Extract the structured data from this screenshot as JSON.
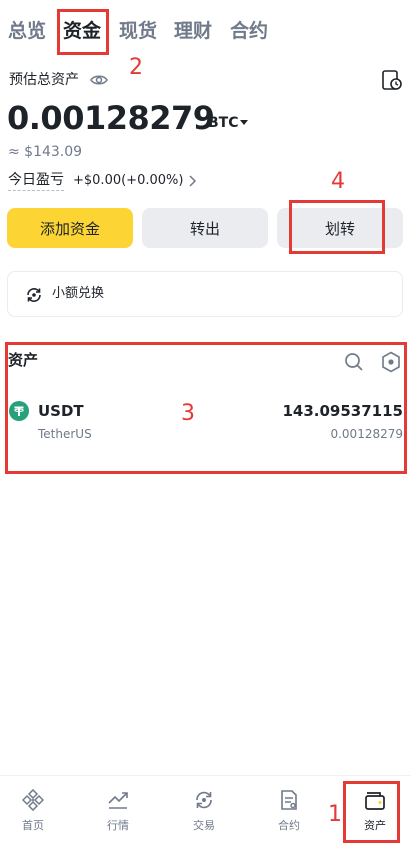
{
  "tabs": [
    {
      "label": "总览"
    },
    {
      "label": "资金"
    },
    {
      "label": "现货"
    },
    {
      "label": "理财"
    },
    {
      "label": "合约"
    }
  ],
  "active_tab": "资金",
  "summary": {
    "estimated_label": "预估总资产",
    "balance": "0.00128279",
    "currency": "BTC",
    "approx_fiat": "≈ $143.09",
    "pnl_label": "今日盈亏",
    "pnl_value": "+$0.00(+0.00%)"
  },
  "actions": {
    "add_funds": "添加资金",
    "transfer_out": "转出",
    "transfer": "划转"
  },
  "small_exchange": {
    "label": "小额兑换"
  },
  "assets": {
    "title": "资产",
    "items": [
      {
        "symbol": "USDT",
        "name": "TetherUS",
        "amount": "143.09537115",
        "btc_value": "0.00128279"
      }
    ]
  },
  "bottom_nav": [
    {
      "label": "首页",
      "icon": "home-icon"
    },
    {
      "label": "行情",
      "icon": "markets-icon"
    },
    {
      "label": "交易",
      "icon": "trade-icon"
    },
    {
      "label": "合约",
      "icon": "futures-icon"
    },
    {
      "label": "资产",
      "icon": "wallet-icon"
    }
  ],
  "annotations": [
    "1",
    "2",
    "3",
    "4"
  ],
  "colors": {
    "accent_yellow": "#fcd535",
    "annotation_red": "#e53935",
    "usdt_green": "#26a17b",
    "text_primary": "#1e2329",
    "text_secondary": "#707a8a"
  }
}
